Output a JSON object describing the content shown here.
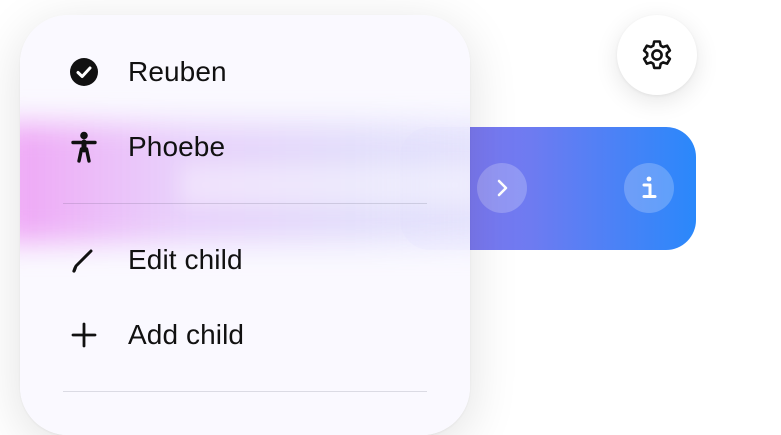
{
  "menu": {
    "items": [
      {
        "label": "Reuben",
        "icon": "checkmark-circle-icon",
        "selected": true
      },
      {
        "label": "Phoebe",
        "icon": "person-icon",
        "selected": false
      },
      {
        "label": "Edit child",
        "icon": "pencil-icon"
      },
      {
        "label": "Add child",
        "icon": "plus-icon"
      }
    ]
  },
  "header": {
    "settings_icon": "gear-icon"
  },
  "banner": {
    "next_icon": "chevron-right-icon",
    "info_icon": "info-icon",
    "gradient_colors": [
      "#8b76f0",
      "#6d7bf1",
      "#2a88fb"
    ]
  }
}
